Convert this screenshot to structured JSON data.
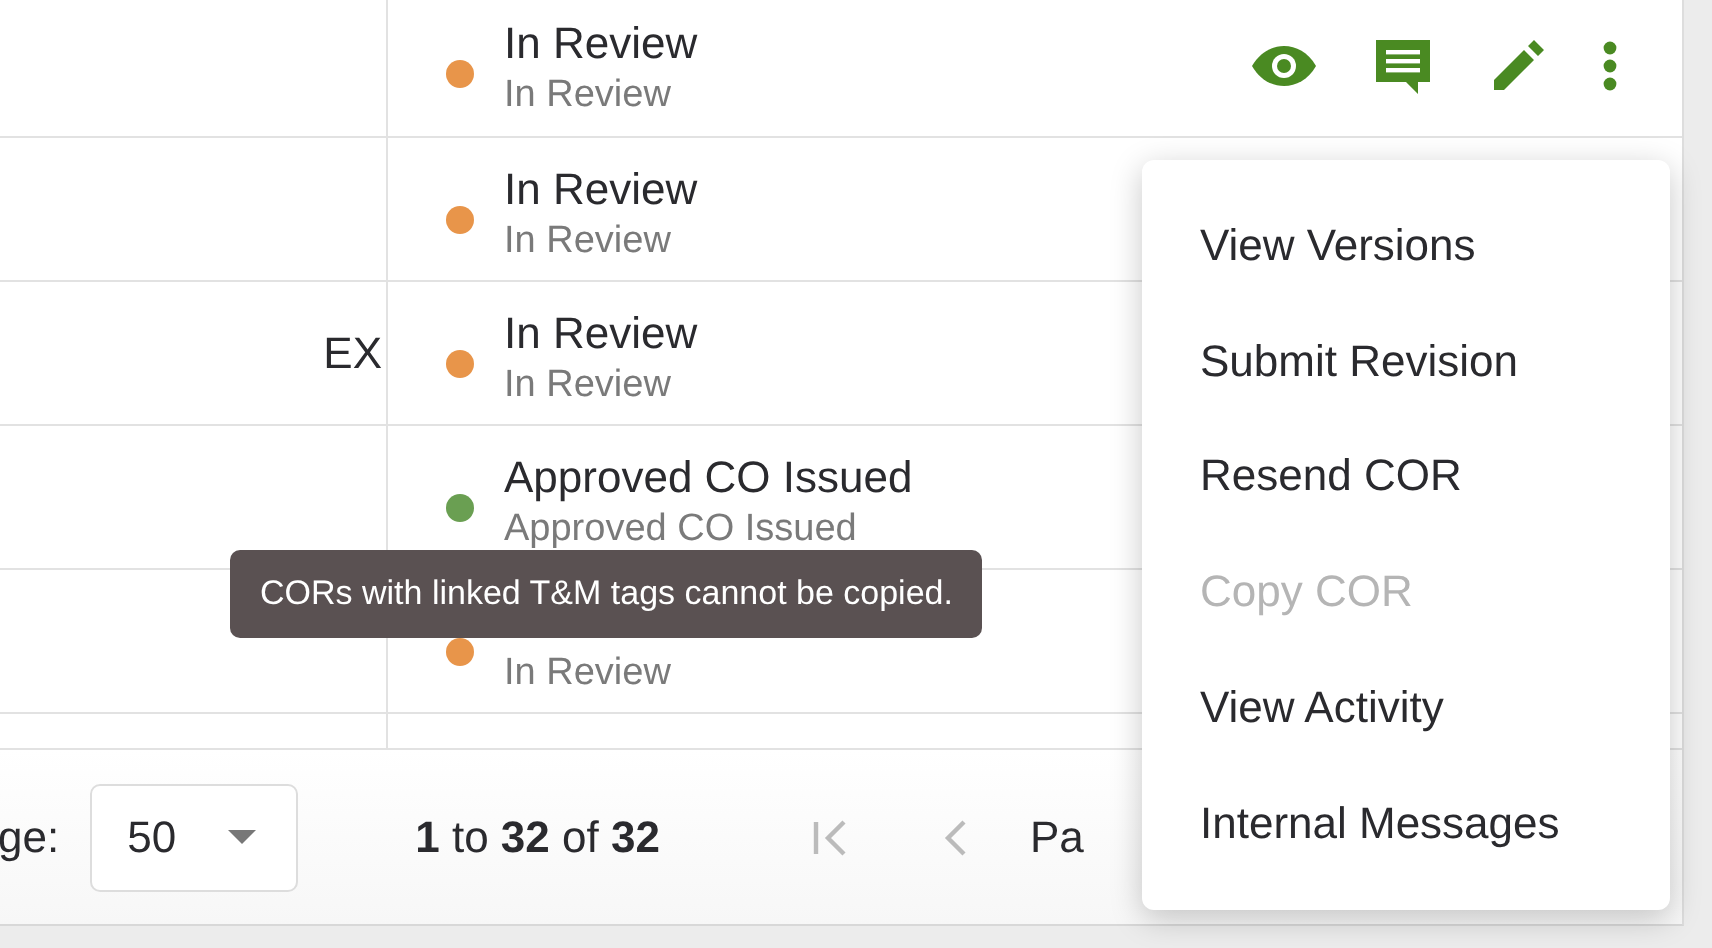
{
  "rows": [
    {
      "status": "In Review",
      "status_detail": "In Review",
      "color": "#e8954a",
      "actions": true
    },
    {
      "status": "In Review",
      "status_detail": "In Review",
      "color": "#e8954a"
    },
    {
      "column_1": "EX",
      "status": "In Review",
      "status_detail": "In Review",
      "color": "#e8954a"
    },
    {
      "status": "Approved CO Issued",
      "status_detail": "Approved CO Issued",
      "color": "#6a9f52"
    },
    {
      "status_detail": "In Review",
      "color": "#e8954a"
    }
  ],
  "tooltip": "CORs with linked T&M tags cannot be copied.",
  "menu": {
    "items": [
      {
        "label": "View Versions",
        "disabled": false
      },
      {
        "label": "Submit Revision",
        "disabled": false
      },
      {
        "label": "Resend COR",
        "disabled": false
      },
      {
        "label": "Copy COR",
        "disabled": true
      },
      {
        "label": "View Activity",
        "disabled": false
      },
      {
        "label": "Internal Messages",
        "disabled": false
      }
    ]
  },
  "pagination": {
    "page_size_label": "ge:",
    "page_size": "50",
    "range": "**1** to **32** of **32**",
    "page_label": "Pa"
  }
}
